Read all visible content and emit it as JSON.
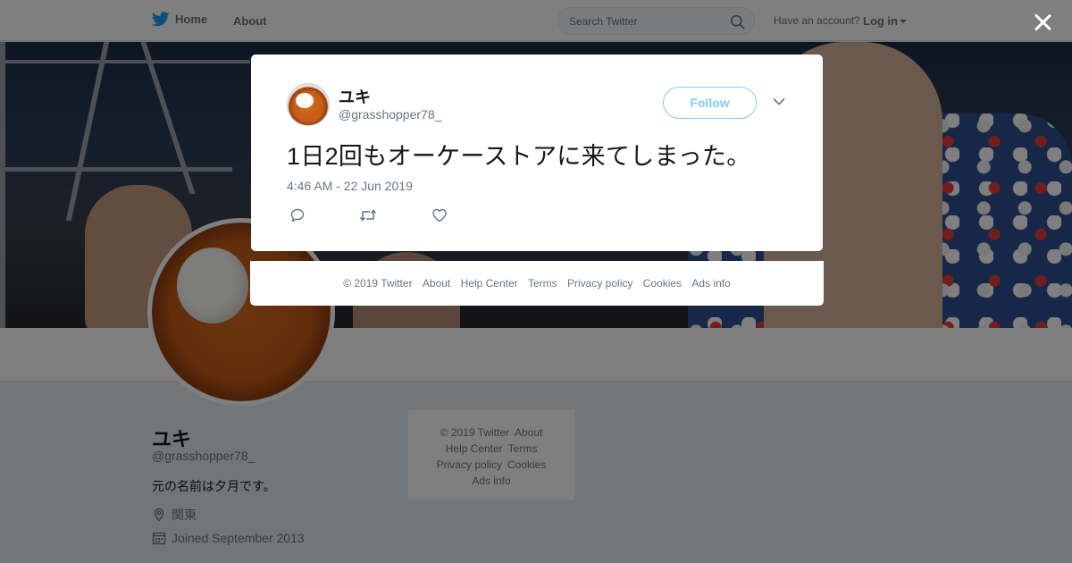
{
  "topbar": {
    "home_label": "Home",
    "about_label": "About",
    "search_placeholder": "Search Twitter",
    "account_prompt": "Have an account?",
    "login_label": "Log in"
  },
  "profile": {
    "name": "ユキ",
    "handle": "@grasshopper78_",
    "bio": "元の名前は夕月です。",
    "location": "関東",
    "joined": "Joined September 2013"
  },
  "side_footer": {
    "line1": [
      "© 2019 Twitter",
      "About"
    ],
    "line2": [
      "Help Center",
      "Terms"
    ],
    "line3": [
      "Privacy policy",
      "Cookies"
    ],
    "line4": [
      "Ads info"
    ]
  },
  "tweet_modal": {
    "name": "ユキ",
    "handle": "@grasshopper78_",
    "follow_label": "Follow",
    "text": "1日2回もオーケーストアに来てしまった。",
    "timestamp": "4:46 AM - 22 Jun 2019"
  },
  "modal_footer": {
    "copyright": "© 2019 Twitter",
    "about": "About",
    "help": "Help Center",
    "terms": "Terms",
    "privacy": "Privacy policy",
    "cookies": "Cookies",
    "ads": "Ads info"
  },
  "colors": {
    "brand_blue": "#1da1f2",
    "muted_text": "#657786",
    "overlay": "rgba(0,0,0,0.5)"
  },
  "icons": [
    "twitter-bird-icon",
    "search-icon",
    "close-icon",
    "chevron-down-icon",
    "reply-icon",
    "retweet-icon",
    "like-icon",
    "location-icon",
    "calendar-icon"
  ]
}
